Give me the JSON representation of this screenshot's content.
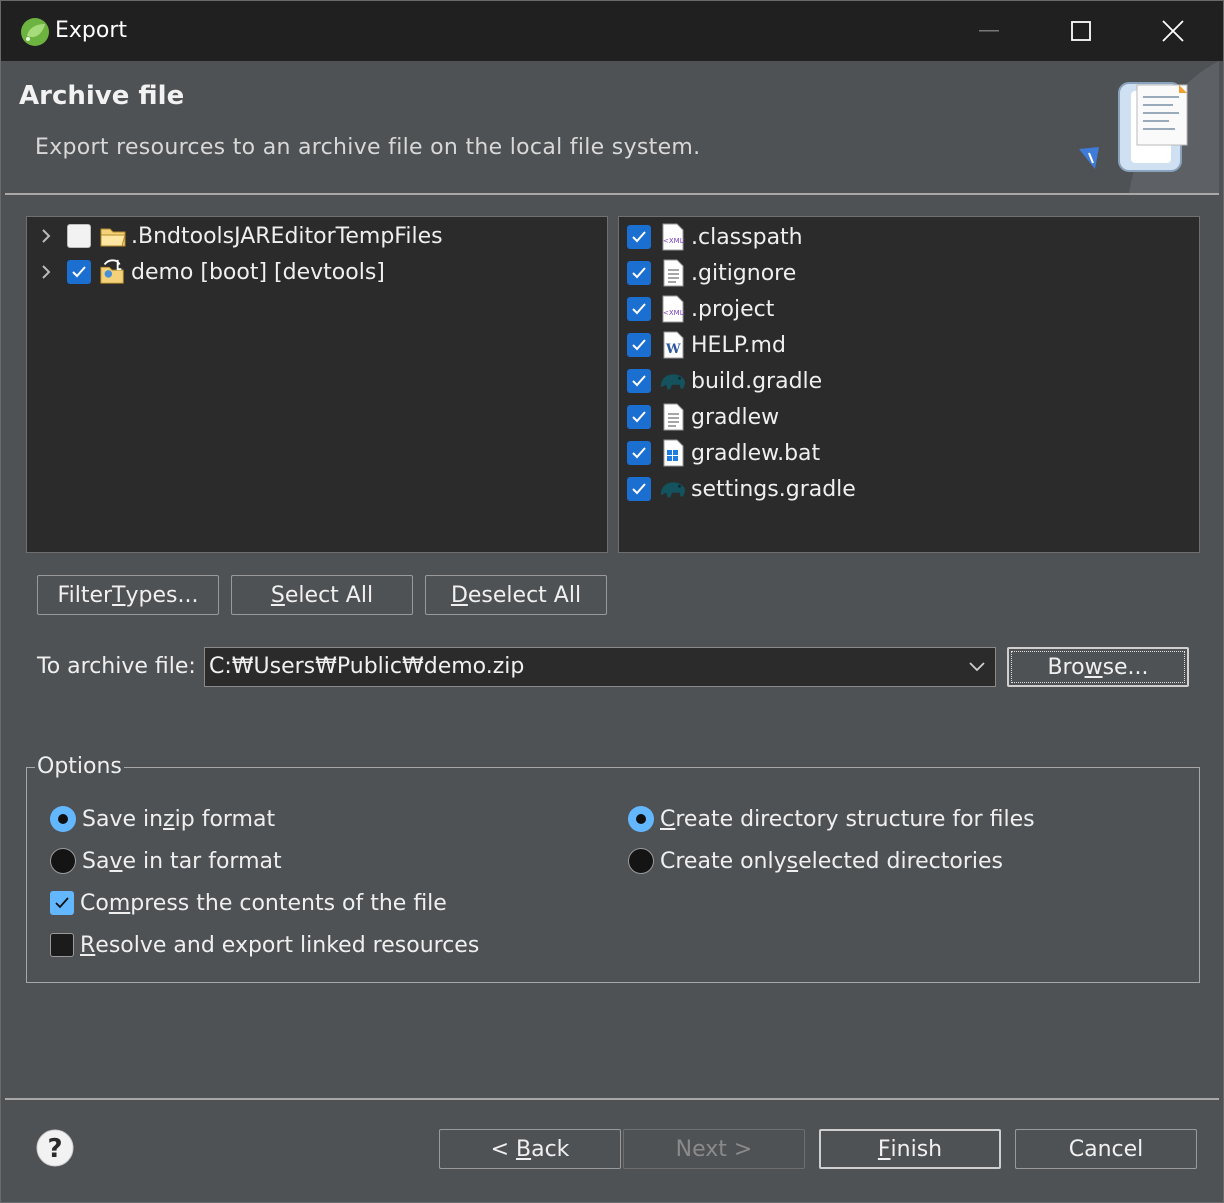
{
  "window": {
    "title": "Export",
    "minimize": "minimize",
    "maximize": "maximize",
    "close": "close"
  },
  "header": {
    "title": "Archive file",
    "description": "Export resources to an archive file on the local file system."
  },
  "left_tree": [
    {
      "label": ".BndtoolsJAREditorTempFiles",
      "checked": false,
      "icon": "folder-icon"
    },
    {
      "label": "demo [boot] [devtools]",
      "checked": true,
      "icon": "project-folder-icon"
    }
  ],
  "right_list": [
    {
      "label": ".classpath",
      "checked": true,
      "icon": "xml-file-icon"
    },
    {
      "label": ".gitignore",
      "checked": true,
      "icon": "text-file-icon"
    },
    {
      "label": ".project",
      "checked": true,
      "icon": "xml-file-icon"
    },
    {
      "label": "HELP.md",
      "checked": true,
      "icon": "word-file-icon"
    },
    {
      "label": "build.gradle",
      "checked": true,
      "icon": "gradle-elephant-icon"
    },
    {
      "label": "gradlew",
      "checked": true,
      "icon": "text-file-icon"
    },
    {
      "label": "gradlew.bat",
      "checked": true,
      "icon": "windows-batch-icon"
    },
    {
      "label": "settings.gradle",
      "checked": true,
      "icon": "gradle-elephant-icon"
    }
  ],
  "selection_buttons": {
    "filter_pre": "Filter ",
    "filter_u": "T",
    "filter_post": "ypes...",
    "select_u": "S",
    "select_post": "elect All",
    "deselect_u": "D",
    "deselect_post": "eselect All"
  },
  "archive": {
    "label": "To archive file:",
    "value": "C:₩Users₩Public₩demo.zip",
    "browse_pre": "Bro",
    "browse_u": "w",
    "browse_post": "se..."
  },
  "options": {
    "legend": "Options",
    "zip": {
      "pre": "Save in ",
      "u": "z",
      "post": "ip format",
      "selected": true
    },
    "tar": {
      "pre": "Sa",
      "u": "v",
      "post": "e in tar format",
      "selected": false
    },
    "compress": {
      "pre": "Co",
      "u": "m",
      "post": "press the contents of the file",
      "checked": true
    },
    "resolve": {
      "pre": "",
      "u": "R",
      "post": "esolve and export linked resources",
      "checked": false
    },
    "dir_struct": {
      "pre": "",
      "u": "C",
      "post": "reate directory structure for files",
      "selected": true
    },
    "only_selected": {
      "pre": "Create only ",
      "u": "s",
      "post": "elected directories",
      "selected": false
    }
  },
  "footer": {
    "back_pre": "< ",
    "back_u": "B",
    "back_post": "ack",
    "next": "Next >",
    "finish_u": "F",
    "finish_post": "inish",
    "cancel": "Cancel"
  },
  "colors": {
    "checkbox_on": "#1a6fd1",
    "radio_on": "#62b7ff",
    "dialog_bg": "#4f5255",
    "pane_bg": "#2b2b2b",
    "titlebar_bg": "#202020"
  }
}
